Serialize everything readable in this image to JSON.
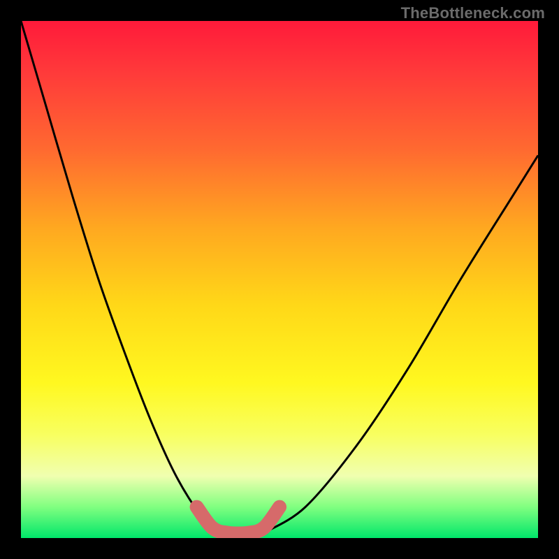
{
  "watermark": "TheBottleneck.com",
  "chart_data": {
    "type": "line",
    "title": "",
    "xlabel": "",
    "ylabel": "",
    "xlim": [
      0,
      1
    ],
    "ylim": [
      0,
      1
    ],
    "grid": false,
    "legend": false,
    "background": "vertical gradient red→orange→yellow→green (bottleneck severity scale)",
    "series": [
      {
        "name": "left-curve",
        "x": [
          0.0,
          0.05,
          0.1,
          0.15,
          0.2,
          0.25,
          0.3,
          0.35,
          0.38
        ],
        "y": [
          1.0,
          0.83,
          0.66,
          0.5,
          0.36,
          0.23,
          0.12,
          0.04,
          0.01
        ]
      },
      {
        "name": "right-curve",
        "x": [
          0.47,
          0.55,
          0.65,
          0.75,
          0.85,
          0.95,
          1.0
        ],
        "y": [
          0.01,
          0.06,
          0.18,
          0.33,
          0.5,
          0.66,
          0.74
        ]
      },
      {
        "name": "bottom-accent",
        "note": "thick pink U segment marking the minimum",
        "x": [
          0.34,
          0.37,
          0.4,
          0.44,
          0.47,
          0.5
        ],
        "y": [
          0.06,
          0.02,
          0.01,
          0.01,
          0.02,
          0.06
        ]
      }
    ]
  }
}
